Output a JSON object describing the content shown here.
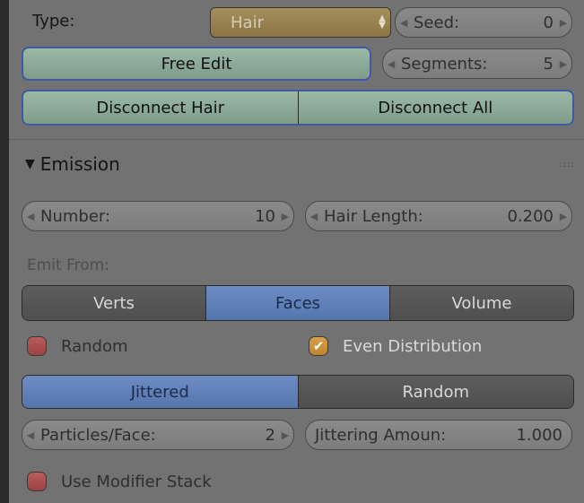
{
  "top": {
    "type_label": "Type:",
    "type_value": "Hair",
    "seed_label": "Seed:",
    "seed_value": "0",
    "free_edit_label": "Free Edit",
    "segments_label": "Segments:",
    "segments_value": "5",
    "disconnect_hair_label": "Disconnect Hair",
    "disconnect_all_label": "Disconnect All"
  },
  "emission": {
    "title": "Emission",
    "number_label": "Number:",
    "number_value": "10",
    "hair_length_label": "Hair Length:",
    "hair_length_value": "0.200",
    "emit_from_label": "Emit From:",
    "emit_from_options": [
      "Verts",
      "Faces",
      "Volume"
    ],
    "emit_from_selected": "Faces",
    "random_checkbox": {
      "label": "Random",
      "checked": false
    },
    "even_distribution_checkbox": {
      "label": "Even Distribution",
      "checked": true
    },
    "distribution_options": [
      "Jittered",
      "Random"
    ],
    "distribution_selected": "Jittered",
    "particles_face_label": "Particles/Face:",
    "particles_face_value": "2",
    "jittering_label": "Jittering Amoun:",
    "jittering_value": "1.000",
    "use_modifier_stack": {
      "label": "Use Modifier Stack",
      "checked": false
    }
  },
  "colors": {
    "panel_bg": "#727272",
    "accent_blue": "#5576ad",
    "button_green": "#8faa99",
    "dropdown_gold": "#9a8452"
  }
}
